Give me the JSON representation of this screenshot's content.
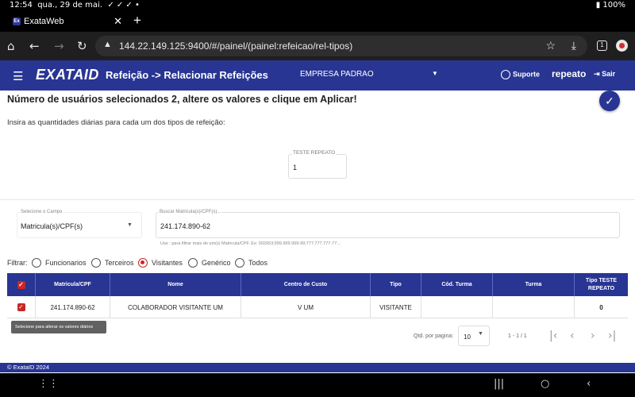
{
  "statusbar": {
    "time": "12:54",
    "date": "qua., 29 de mai.",
    "icons": "✓ ✓ ✓ •",
    "battery": "100%",
    "right_icons": "⏰ 🔇 ▾"
  },
  "browser": {
    "tab_title": "ExataWeb",
    "favicon": "Ex",
    "url": "144.22.149.125:9400/#/painel/(painel:refeicao/rel-tipos)",
    "tab_count": "1"
  },
  "header": {
    "logo": "EXATA",
    "logo_suffix": "ID",
    "title": "Refeição -> Relacionar Refeições",
    "empresa": "EMPRESA PADRAO",
    "suporte": "Suporte",
    "user": "repeato",
    "sair": "Sair"
  },
  "content": {
    "message": "Número de usuários selecionados 2, altere os valores e clique em Aplicar!",
    "instruction": "Insira as quantidades diárias para cada um dos tipos de refeição:",
    "qty_label": "TESTE REPEATO",
    "qty_value": "1"
  },
  "search": {
    "campo_label": "Selecione o Campo",
    "campo_value": "Matricula(s)/CPF(s)",
    "busca_label": "Buscar Matricula(s)/CPF(s)...",
    "busca_value": "241.174.890-62",
    "hint": "Use ; para filtrar mais de um(s) Matricula/CPF. Ex: 002653;999.999.999-99;777.777.777-77..."
  },
  "filter": {
    "label": "Filtrar:",
    "options": [
      "Funcionarios",
      "Terceiros",
      "Visitantes",
      "Genérico",
      "Todos"
    ],
    "selected": "Visitantes"
  },
  "table": {
    "headers": [
      "Matricula/CPF",
      "Nome",
      "Centro de Custo",
      "Tipo",
      "Cód. Turma",
      "Turma",
      "Tipo TESTE REPEATO"
    ],
    "rows": [
      {
        "cpf": "241.174.890-62",
        "nome": "COLABORADOR VISITANTE UM",
        "centro": "V UM",
        "tipo": "VISITANTE",
        "cod_turma": "",
        "turma": "",
        "qtd": "0"
      }
    ]
  },
  "tooltip": "Selecione para alterar os valores diários",
  "pagination": {
    "label": "Qtd. por pagina:",
    "per_page": "10",
    "range": "1 - 1 / 1"
  },
  "footer": "© ExataID 2024",
  "colors": {
    "primary": "#283593",
    "accent": "#c62828"
  }
}
